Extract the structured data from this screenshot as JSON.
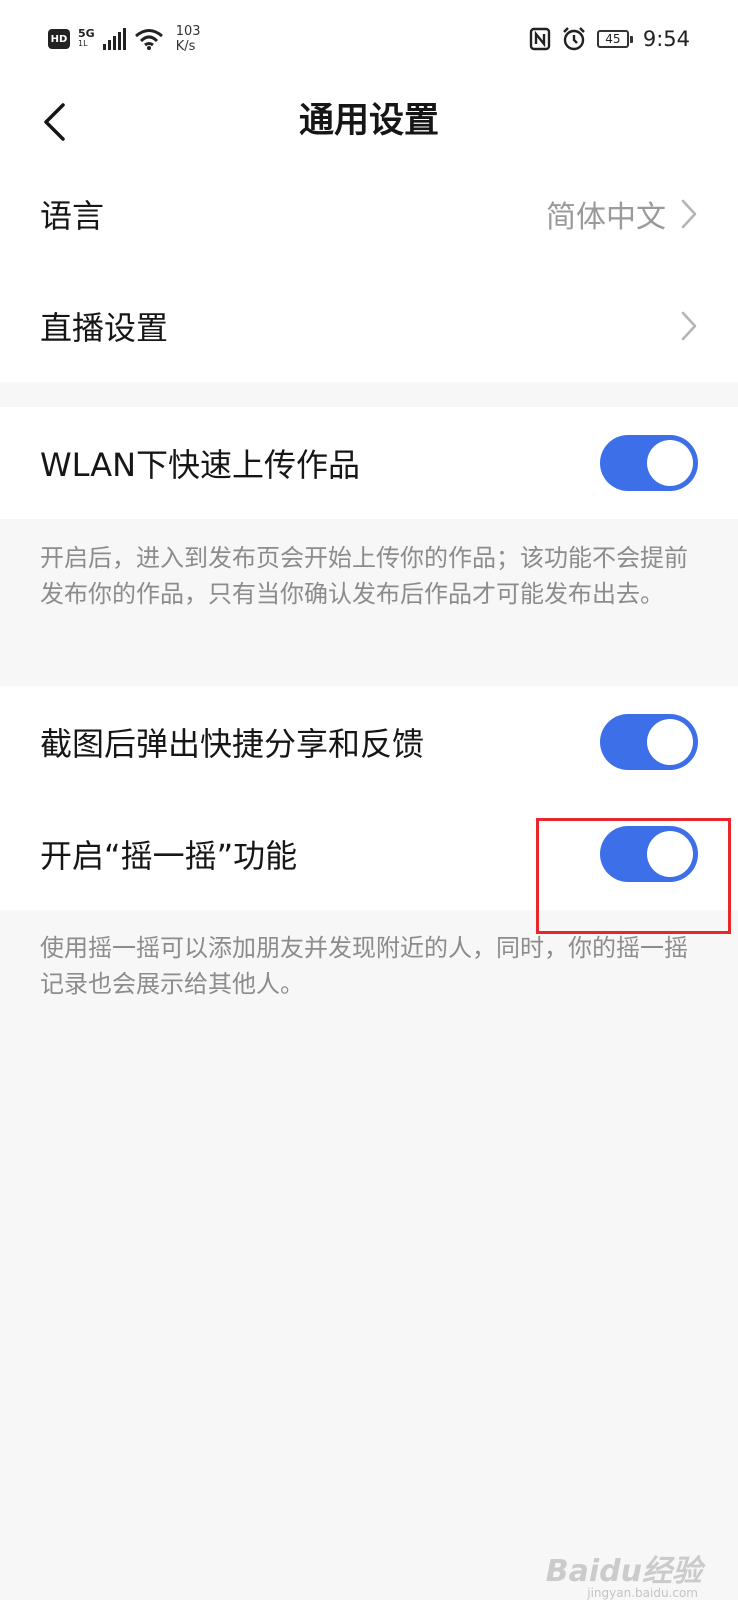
{
  "status_bar": {
    "hd": "HD",
    "network_gen": "5G",
    "network_sub": "1L",
    "speed_value": "103",
    "speed_unit": "K/s",
    "battery": "45",
    "time": "9:54",
    "icons": [
      "nfc-icon",
      "alarm-icon",
      "wifi-icon",
      "signal-icon"
    ]
  },
  "nav": {
    "title": "通用设置",
    "back_icon": "chevron-left-icon"
  },
  "group1": {
    "items": [
      {
        "label": "语言",
        "value": "简体中文"
      },
      {
        "label": "直播设置",
        "value": ""
      }
    ]
  },
  "group2": {
    "wlan_upload": {
      "label": "WLAN下快速上传作品",
      "on": true
    },
    "wlan_desc": "开启后，进入到发布页会开始上传你的作品；该功能不会提前发布你的作品，只有当你确认发布后作品才可能发布出去。"
  },
  "group3": {
    "screenshot_share": {
      "label": "截图后弹出快捷分享和反馈",
      "on": true
    },
    "shake": {
      "label": "开启“摇一摇”功能",
      "on": true
    },
    "shake_desc": "使用摇一摇可以添加朋友并发现附近的人，同时，你的摇一摇记录也会展示给其他人。"
  },
  "colors": {
    "accent": "#3c6fe8",
    "highlight": "#e8262c"
  },
  "watermark": {
    "main": "Baidu经验",
    "sub": "jingyan.baidu.com"
  }
}
